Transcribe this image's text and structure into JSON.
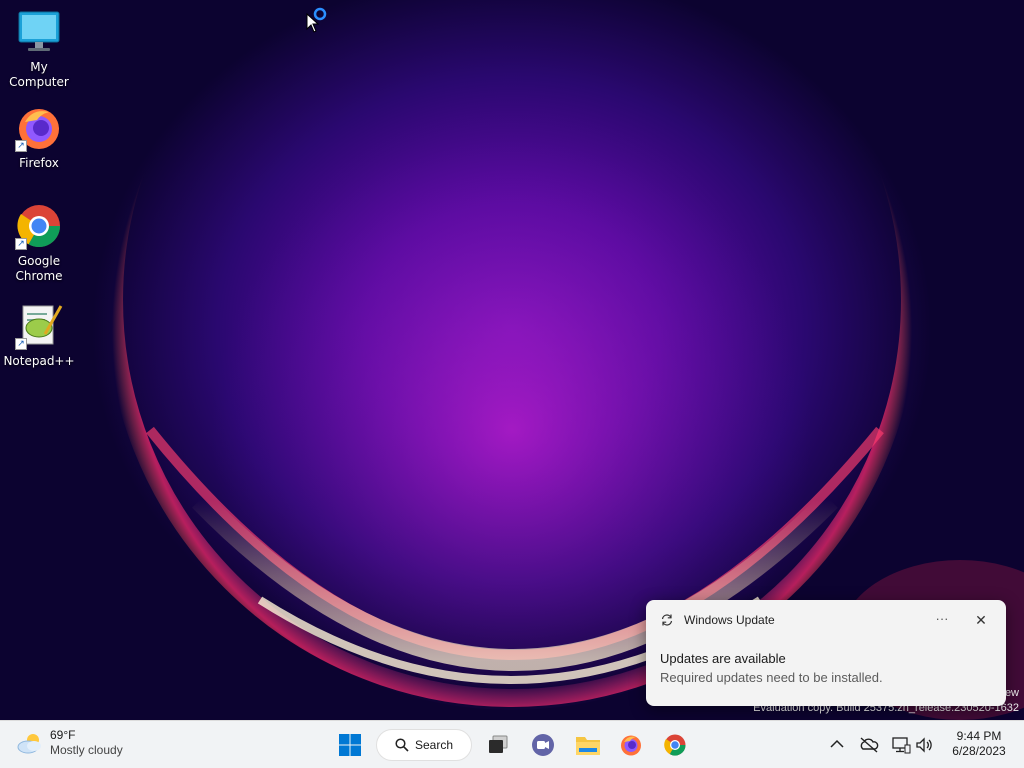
{
  "desktop": {
    "icons": [
      {
        "label": "My Computer"
      },
      {
        "label": "Firefox"
      },
      {
        "label": "Google Chrome"
      },
      {
        "label": "Notepad++"
      }
    ],
    "watermark": {
      "line1": "ew",
      "line2": "Evaluation copy. Build 25375.zn_release.230520-1632"
    }
  },
  "notification": {
    "app_name": "Windows Update",
    "more_label": "···",
    "close_label": "✕",
    "title": "Updates are available",
    "body": "Required updates need to be installed."
  },
  "taskbar": {
    "weather": {
      "temp": "69°F",
      "condition": "Mostly cloudy"
    },
    "search_label": "Search",
    "pinned_apps": [
      "start-icon",
      "task-view-icon",
      "teams-chat-icon",
      "file-explorer-icon",
      "firefox-icon",
      "chrome-icon"
    ],
    "clock": {
      "time": "9:44 PM",
      "date": "6/28/2023"
    }
  },
  "colors": {
    "accent": "#0067c0",
    "taskbar_bg": "#f1f3f5",
    "toast_bg": "#f3f3f3"
  }
}
